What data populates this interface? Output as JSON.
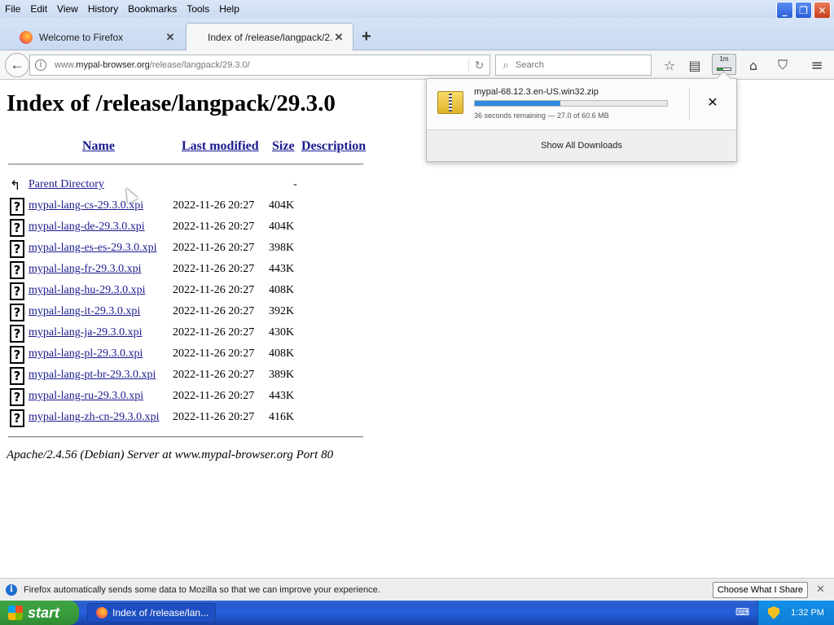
{
  "menubar": {
    "items": [
      "File",
      "Edit",
      "View",
      "History",
      "Bookmarks",
      "Tools",
      "Help"
    ]
  },
  "tabs": [
    {
      "title": "Welcome to Firefox",
      "active": false
    },
    {
      "title": "Index of /release/langpack/2...",
      "active": true
    }
  ],
  "navbar": {
    "url_domain_prefix": "www.",
    "url_domain": "mypal-browser.org",
    "url_path": "/release/langpack/29.3.0/",
    "search_placeholder": "Search",
    "download_badge": "1m",
    "download_progress": 0.45
  },
  "page": {
    "title": "Index of /release/langpack/29.3.0",
    "headers": {
      "name": "Name",
      "modified": "Last modified",
      "size": "Size",
      "description": "Description"
    },
    "parent": {
      "name": "Parent Directory",
      "size": "-"
    },
    "files": [
      {
        "name": "mypal-lang-cs-29.3.0.xpi",
        "date": "2022-11-26 20:27",
        "size": "404K"
      },
      {
        "name": "mypal-lang-de-29.3.0.xpi",
        "date": "2022-11-26 20:27",
        "size": "404K"
      },
      {
        "name": "mypal-lang-es-es-29.3.0.xpi",
        "date": "2022-11-26 20:27",
        "size": "398K"
      },
      {
        "name": "mypal-lang-fr-29.3.0.xpi",
        "date": "2022-11-26 20:27",
        "size": "443K"
      },
      {
        "name": "mypal-lang-hu-29.3.0.xpi",
        "date": "2022-11-26 20:27",
        "size": "408K"
      },
      {
        "name": "mypal-lang-it-29.3.0.xpi",
        "date": "2022-11-26 20:27",
        "size": "392K"
      },
      {
        "name": "mypal-lang-ja-29.3.0.xpi",
        "date": "2022-11-26 20:27",
        "size": "430K"
      },
      {
        "name": "mypal-lang-pl-29.3.0.xpi",
        "date": "2022-11-26 20:27",
        "size": "408K"
      },
      {
        "name": "mypal-lang-pt-br-29.3.0.xpi",
        "date": "2022-11-26 20:27",
        "size": "389K"
      },
      {
        "name": "mypal-lang-ru-29.3.0.xpi",
        "date": "2022-11-26 20:27",
        "size": "443K"
      },
      {
        "name": "mypal-lang-zh-cn-29.3.0.xpi",
        "date": "2022-11-26 20:27",
        "size": "416K"
      }
    ],
    "server_signature": "Apache/2.4.56 (Debian) Server at www.mypal-browser.org Port 80"
  },
  "downloads_panel": {
    "filename": "mypal-68.12.3.en-US.win32.zip",
    "progress": 0.446,
    "status": "36 seconds remaining — 27.0 of 60.6 MB",
    "show_all": "Show All Downloads"
  },
  "notification": {
    "message": "Firefox automatically sends some data to Mozilla so that we can improve your experience.",
    "button": "Choose What I Share"
  },
  "taskbar": {
    "start_label": "start",
    "task_title": "Index of /release/lan...",
    "clock": "1:32 PM"
  },
  "colors": {
    "link": "#1a1a8f",
    "progress_blue": "#2f8ae0",
    "taskbar_blue": "#245edb",
    "start_green": "#3a9e3e"
  }
}
